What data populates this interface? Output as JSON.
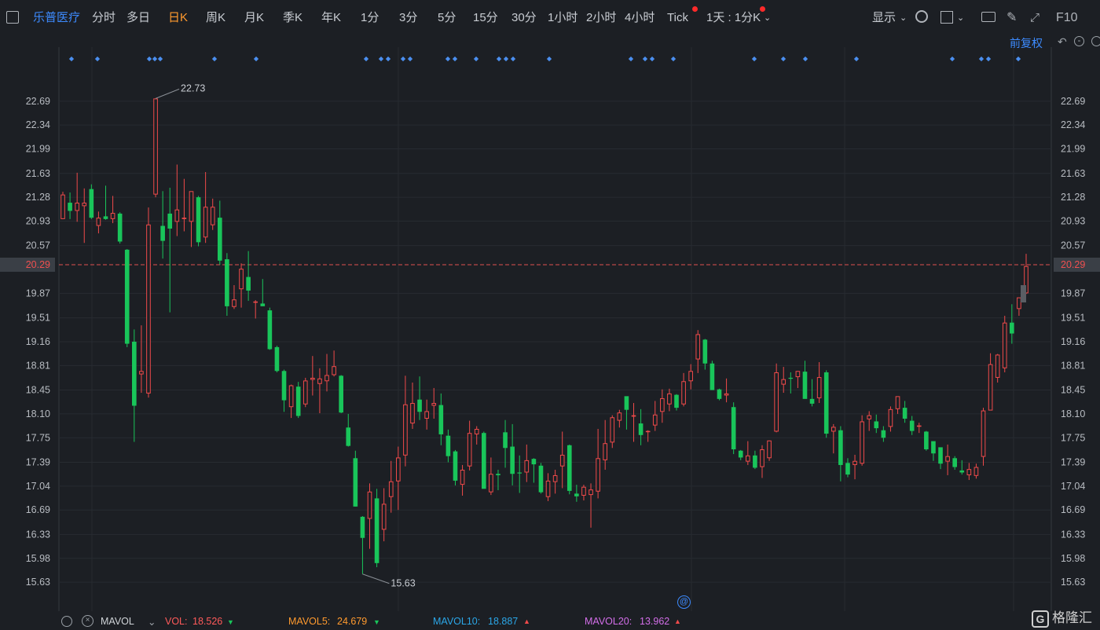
{
  "toolbar": {
    "stock_name": "乐普医疗",
    "periods": [
      "分时",
      "多日",
      "日K",
      "周K",
      "月K",
      "季K",
      "年K",
      "1分",
      "3分",
      "5分",
      "15分",
      "30分",
      "1小时",
      "2小时",
      "4小时",
      "Tick"
    ],
    "active_period": "日K",
    "multi_period": "1天 : 1分K",
    "display_label": "显示",
    "f10_label": "F10"
  },
  "adjust_label": "前复权",
  "colors": {
    "up": "#f04a4a",
    "down": "#19c55a",
    "bg": "#1c1f24",
    "accent": "#3d8bff",
    "price_line": "#e05050"
  },
  "chart_data": {
    "type": "candlestick",
    "y_ticks": [
      "22.69",
      "22.34",
      "21.99",
      "21.63",
      "21.28",
      "20.93",
      "20.57",
      "20.29",
      "19.87",
      "19.51",
      "19.16",
      "18.81",
      "18.45",
      "18.10",
      "17.75",
      "17.39",
      "17.04",
      "16.69",
      "16.33",
      "15.98",
      "15.63"
    ],
    "last_price": "20.29",
    "ylim": [
      15.47,
      23.08
    ],
    "high_label": "22.73",
    "low_label": "15.63",
    "candles": [
      {
        "o": 20.96,
        "h": 21.36,
        "l": 20.96,
        "c": 21.32
      },
      {
        "o": 21.2,
        "h": 21.35,
        "l": 20.96,
        "c": 21.08
      },
      {
        "o": 21.08,
        "h": 21.64,
        "l": 20.92,
        "c": 21.2
      },
      {
        "o": 21.15,
        "h": 21.41,
        "l": 20.61,
        "c": 21.2
      },
      {
        "o": 21.4,
        "h": 21.47,
        "l": 20.96,
        "c": 20.98
      },
      {
        "o": 20.86,
        "h": 21.07,
        "l": 20.75,
        "c": 20.98
      },
      {
        "o": 21.0,
        "h": 21.45,
        "l": 20.95,
        "c": 20.96
      },
      {
        "o": 20.96,
        "h": 21.3,
        "l": 20.9,
        "c": 21.05
      },
      {
        "o": 21.04,
        "h": 21.06,
        "l": 20.6,
        "c": 20.63
      },
      {
        "o": 20.51,
        "h": 20.52,
        "l": 19.08,
        "c": 19.13
      },
      {
        "o": 19.16,
        "h": 19.34,
        "l": 17.69,
        "c": 18.22
      },
      {
        "o": 18.68,
        "h": 19.4,
        "l": 18.41,
        "c": 18.73
      },
      {
        "o": 18.4,
        "h": 21.13,
        "l": 18.34,
        "c": 20.88
      },
      {
        "o": 21.32,
        "h": 22.73,
        "l": 21.28,
        "c": 22.73
      },
      {
        "o": 20.86,
        "h": 21.37,
        "l": 20.38,
        "c": 20.64
      },
      {
        "o": 21.04,
        "h": 21.42,
        "l": 19.59,
        "c": 20.82
      },
      {
        "o": 20.92,
        "h": 21.76,
        "l": 20.71,
        "c": 21.1
      },
      {
        "o": 20.96,
        "h": 21.55,
        "l": 20.78,
        "c": 20.98
      },
      {
        "o": 20.92,
        "h": 21.33,
        "l": 20.55,
        "c": 21.37
      },
      {
        "o": 21.28,
        "h": 21.3,
        "l": 20.56,
        "c": 20.62
      },
      {
        "o": 20.69,
        "h": 21.65,
        "l": 20.61,
        "c": 21.14
      },
      {
        "o": 20.87,
        "h": 21.26,
        "l": 20.8,
        "c": 21.14
      },
      {
        "o": 20.98,
        "h": 21.23,
        "l": 20.29,
        "c": 20.35
      },
      {
        "o": 20.37,
        "h": 20.46,
        "l": 19.54,
        "c": 19.68
      },
      {
        "o": 19.67,
        "h": 19.99,
        "l": 19.64,
        "c": 19.78
      },
      {
        "o": 19.93,
        "h": 20.31,
        "l": 19.66,
        "c": 20.23
      },
      {
        "o": 20.11,
        "h": 20.49,
        "l": 19.76,
        "c": 19.91
      },
      {
        "o": 19.74,
        "h": 19.77,
        "l": 19.5,
        "c": 19.75
      },
      {
        "o": 19.72,
        "h": 20.08,
        "l": 19.69,
        "c": 19.68
      },
      {
        "o": 19.62,
        "h": 19.66,
        "l": 19.04,
        "c": 19.05
      },
      {
        "o": 19.08,
        "h": 19.1,
        "l": 18.71,
        "c": 18.73
      },
      {
        "o": 18.73,
        "h": 18.75,
        "l": 18.13,
        "c": 18.3
      },
      {
        "o": 18.2,
        "h": 18.53,
        "l": 18.04,
        "c": 18.52
      },
      {
        "o": 18.5,
        "h": 18.57,
        "l": 18.04,
        "c": 18.07
      },
      {
        "o": 18.24,
        "h": 18.63,
        "l": 18.2,
        "c": 18.59
      },
      {
        "o": 18.6,
        "h": 18.95,
        "l": 18.37,
        "c": 18.63
      },
      {
        "o": 18.54,
        "h": 18.77,
        "l": 18.11,
        "c": 18.62
      },
      {
        "o": 18.58,
        "h": 18.98,
        "l": 18.43,
        "c": 18.67
      },
      {
        "o": 18.67,
        "h": 19.03,
        "l": 18.65,
        "c": 18.8
      },
      {
        "o": 18.66,
        "h": 18.67,
        "l": 18.11,
        "c": 18.12
      },
      {
        "o": 17.9,
        "h": 18.1,
        "l": 17.62,
        "c": 17.63
      },
      {
        "o": 17.45,
        "h": 17.56,
        "l": 16.74,
        "c": 16.74
      },
      {
        "o": 16.59,
        "h": 16.6,
        "l": 15.75,
        "c": 16.28
      },
      {
        "o": 16.56,
        "h": 17.08,
        "l": 16.12,
        "c": 16.96
      },
      {
        "o": 16.86,
        "h": 17.0,
        "l": 15.85,
        "c": 15.91
      },
      {
        "o": 16.4,
        "h": 17.01,
        "l": 16.23,
        "c": 16.78
      },
      {
        "o": 16.88,
        "h": 17.41,
        "l": 16.65,
        "c": 17.11
      },
      {
        "o": 17.11,
        "h": 17.62,
        "l": 16.69,
        "c": 17.46
      },
      {
        "o": 17.49,
        "h": 18.66,
        "l": 17.33,
        "c": 18.24
      },
      {
        "o": 17.96,
        "h": 18.56,
        "l": 17.88,
        "c": 18.26
      },
      {
        "o": 18.31,
        "h": 18.65,
        "l": 18.01,
        "c": 18.13
      },
      {
        "o": 18.03,
        "h": 18.31,
        "l": 17.87,
        "c": 18.14
      },
      {
        "o": 18.22,
        "h": 18.48,
        "l": 18.03,
        "c": 18.26
      },
      {
        "o": 18.23,
        "h": 18.4,
        "l": 17.64,
        "c": 17.8
      },
      {
        "o": 17.78,
        "h": 17.87,
        "l": 17.39,
        "c": 17.48
      },
      {
        "o": 17.55,
        "h": 17.57,
        "l": 17.05,
        "c": 17.12
      },
      {
        "o": 17.06,
        "h": 17.35,
        "l": 16.9,
        "c": 17.28
      },
      {
        "o": 17.33,
        "h": 18.0,
        "l": 17.27,
        "c": 17.82
      },
      {
        "o": 17.8,
        "h": 17.92,
        "l": 17.65,
        "c": 17.88
      },
      {
        "o": 17.82,
        "h": 17.84,
        "l": 17.08,
        "c": 17.0
      },
      {
        "o": 16.95,
        "h": 17.46,
        "l": 16.91,
        "c": 17.22
      },
      {
        "o": 17.22,
        "h": 17.28,
        "l": 16.98,
        "c": 17.2
      },
      {
        "o": 17.83,
        "h": 18.01,
        "l": 17.31,
        "c": 17.6
      },
      {
        "o": 17.62,
        "h": 17.95,
        "l": 17.05,
        "c": 17.22
      },
      {
        "o": 17.24,
        "h": 17.49,
        "l": 16.94,
        "c": 17.23
      },
      {
        "o": 17.24,
        "h": 17.65,
        "l": 17.1,
        "c": 17.42
      },
      {
        "o": 17.44,
        "h": 17.45,
        "l": 17.09,
        "c": 17.36
      },
      {
        "o": 17.34,
        "h": 17.38,
        "l": 16.93,
        "c": 16.95
      },
      {
        "o": 16.88,
        "h": 17.23,
        "l": 16.82,
        "c": 17.12
      },
      {
        "o": 17.1,
        "h": 17.28,
        "l": 16.93,
        "c": 17.2
      },
      {
        "o": 17.33,
        "h": 17.84,
        "l": 17.01,
        "c": 17.5
      },
      {
        "o": 17.64,
        "h": 17.65,
        "l": 16.92,
        "c": 16.97
      },
      {
        "o": 16.93,
        "h": 17.06,
        "l": 16.81,
        "c": 16.89
      },
      {
        "o": 16.9,
        "h": 17.06,
        "l": 16.83,
        "c": 17.03
      },
      {
        "o": 16.91,
        "h": 17.08,
        "l": 16.43,
        "c": 16.99
      },
      {
        "o": 16.96,
        "h": 17.88,
        "l": 16.86,
        "c": 17.45
      },
      {
        "o": 17.42,
        "h": 18.01,
        "l": 17.28,
        "c": 17.67
      },
      {
        "o": 17.68,
        "h": 18.08,
        "l": 17.6,
        "c": 18.05
      },
      {
        "o": 18.0,
        "h": 18.16,
        "l": 17.9,
        "c": 18.12
      },
      {
        "o": 18.36,
        "h": 18.31,
        "l": 17.87,
        "c": 18.16
      },
      {
        "o": 18.06,
        "h": 18.26,
        "l": 17.69,
        "c": 18.08
      },
      {
        "o": 17.96,
        "h": 18.17,
        "l": 17.64,
        "c": 17.79
      },
      {
        "o": 17.84,
        "h": 17.86,
        "l": 17.69,
        "c": 17.85
      },
      {
        "o": 17.93,
        "h": 18.29,
        "l": 17.85,
        "c": 18.09
      },
      {
        "o": 18.13,
        "h": 18.46,
        "l": 17.97,
        "c": 18.33
      },
      {
        "o": 18.24,
        "h": 18.47,
        "l": 18.14,
        "c": 18.4
      },
      {
        "o": 18.38,
        "h": 18.39,
        "l": 18.15,
        "c": 18.19
      },
      {
        "o": 18.24,
        "h": 18.7,
        "l": 18.21,
        "c": 18.58
      },
      {
        "o": 18.58,
        "h": 18.83,
        "l": 18.46,
        "c": 18.73
      },
      {
        "o": 18.9,
        "h": 19.33,
        "l": 18.7,
        "c": 19.27
      },
      {
        "o": 19.19,
        "h": 19.2,
        "l": 18.75,
        "c": 18.84
      },
      {
        "o": 18.84,
        "h": 18.88,
        "l": 18.45,
        "c": 18.45
      },
      {
        "o": 18.46,
        "h": 18.47,
        "l": 18.3,
        "c": 18.32
      },
      {
        "o": 18.37,
        "h": 18.62,
        "l": 18.27,
        "c": 18.4
      },
      {
        "o": 18.2,
        "h": 18.27,
        "l": 17.51,
        "c": 17.58
      },
      {
        "o": 17.56,
        "h": 17.57,
        "l": 17.42,
        "c": 17.46
      },
      {
        "o": 17.4,
        "h": 17.7,
        "l": 17.35,
        "c": 17.49
      },
      {
        "o": 17.49,
        "h": 17.56,
        "l": 17.29,
        "c": 17.31
      },
      {
        "o": 17.32,
        "h": 17.64,
        "l": 17.16,
        "c": 17.58
      },
      {
        "o": 17.45,
        "h": 17.71,
        "l": 17.41,
        "c": 17.71
      },
      {
        "o": 17.84,
        "h": 18.84,
        "l": 17.83,
        "c": 18.71
      },
      {
        "o": 18.53,
        "h": 18.79,
        "l": 18.41,
        "c": 18.61
      },
      {
        "o": 18.63,
        "h": 18.71,
        "l": 18.4,
        "c": 18.62
      },
      {
        "o": 18.64,
        "h": 18.73,
        "l": 18.48,
        "c": 18.73
      },
      {
        "o": 18.72,
        "h": 18.88,
        "l": 18.36,
        "c": 18.32
      },
      {
        "o": 18.32,
        "h": 18.61,
        "l": 18.21,
        "c": 18.25
      },
      {
        "o": 18.33,
        "h": 18.86,
        "l": 18.26,
        "c": 18.64
      },
      {
        "o": 18.71,
        "h": 18.74,
        "l": 17.75,
        "c": 17.81
      },
      {
        "o": 17.84,
        "h": 17.95,
        "l": 17.52,
        "c": 17.91
      },
      {
        "o": 17.86,
        "h": 17.92,
        "l": 17.11,
        "c": 17.35
      },
      {
        "o": 17.38,
        "h": 17.45,
        "l": 17.17,
        "c": 17.21
      },
      {
        "o": 17.35,
        "h": 17.5,
        "l": 17.14,
        "c": 17.41
      },
      {
        "o": 17.37,
        "h": 18.08,
        "l": 17.34,
        "c": 17.99
      },
      {
        "o": 18.02,
        "h": 18.14,
        "l": 17.85,
        "c": 18.08
      },
      {
        "o": 17.99,
        "h": 18.09,
        "l": 17.82,
        "c": 17.89
      },
      {
        "o": 17.86,
        "h": 17.92,
        "l": 17.69,
        "c": 17.75
      },
      {
        "o": 17.91,
        "h": 18.21,
        "l": 17.84,
        "c": 18.17
      },
      {
        "o": 18.17,
        "h": 18.34,
        "l": 18.1,
        "c": 18.36
      },
      {
        "o": 18.19,
        "h": 18.29,
        "l": 17.97,
        "c": 18.03
      },
      {
        "o": 18.0,
        "h": 18.07,
        "l": 17.79,
        "c": 17.85
      },
      {
        "o": 17.93,
        "h": 17.97,
        "l": 17.82,
        "c": 17.93
      },
      {
        "o": 17.84,
        "h": 17.85,
        "l": 17.56,
        "c": 17.58
      },
      {
        "o": 17.7,
        "h": 17.69,
        "l": 17.41,
        "c": 17.52
      },
      {
        "o": 17.61,
        "h": 17.6,
        "l": 17.29,
        "c": 17.37
      },
      {
        "o": 17.4,
        "h": 17.65,
        "l": 17.2,
        "c": 17.48
      },
      {
        "o": 17.45,
        "h": 17.48,
        "l": 17.28,
        "c": 17.32
      },
      {
        "o": 17.27,
        "h": 17.42,
        "l": 17.21,
        "c": 17.24
      },
      {
        "o": 17.2,
        "h": 17.38,
        "l": 17.13,
        "c": 17.29
      },
      {
        "o": 17.19,
        "h": 17.37,
        "l": 17.15,
        "c": 17.32
      },
      {
        "o": 17.47,
        "h": 18.19,
        "l": 17.34,
        "c": 18.15
      },
      {
        "o": 18.15,
        "h": 18.99,
        "l": 18.16,
        "c": 18.83
      },
      {
        "o": 18.63,
        "h": 18.98,
        "l": 18.56,
        "c": 18.97
      },
      {
        "o": 18.77,
        "h": 19.54,
        "l": 18.71,
        "c": 19.44
      },
      {
        "o": 19.44,
        "h": 19.71,
        "l": 19.13,
        "c": 19.28
      },
      {
        "o": 19.64,
        "h": 19.73,
        "l": 19.54,
        "c": 19.81
      },
      {
        "o": 19.87,
        "h": 20.45,
        "l": 19.86,
        "c": 20.27
      }
    ],
    "markers": [
      91,
      124,
      190,
      197,
      204,
      273,
      326,
      466,
      485,
      494,
      513,
      522,
      570,
      579,
      606,
      635,
      644,
      653,
      699,
      803,
      821,
      830,
      857,
      960,
      997,
      1025,
      1090,
      1212,
      1249,
      1258,
      1296
    ],
    "indicator": {
      "name": "MAVOL",
      "items": [
        {
          "label": "VOL:",
          "value": "18.526",
          "dir": "down",
          "color": "#ff5a5a"
        },
        {
          "label": "MAVOL5:",
          "value": "24.679",
          "dir": "down",
          "color": "#ff9a2e"
        },
        {
          "label": "MAVOL10:",
          "value": "18.887",
          "dir": "up",
          "color": "#2ba7e8"
        },
        {
          "label": "MAVOL20:",
          "value": "13.962",
          "dir": "up",
          "color": "#d36ee8"
        }
      ]
    },
    "grid": true
  },
  "logo_text": "格隆汇"
}
